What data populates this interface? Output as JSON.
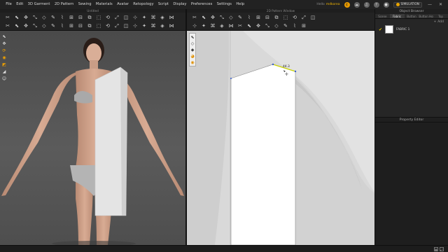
{
  "menubar": {
    "items": [
      "File",
      "Edit",
      "3D Garment",
      "2D Pattern",
      "Sewing",
      "Materials",
      "Avatar",
      "Retopology",
      "Script",
      "Display",
      "Preferences",
      "Settings",
      "Help"
    ],
    "user_prefix": "Hello",
    "user_name": "mdkorea",
    "simulation_label": "SIMULATION",
    "icons": [
      "coin-icon",
      "cloud-icon",
      "headset-icon",
      "help-icon",
      "user-icon"
    ],
    "minimize": "—",
    "close": "✕"
  },
  "window3d": {
    "title": "Untitled",
    "toolbar_icons": 38,
    "side_tools": [
      "select-icon",
      "move-icon",
      "rotate-icon",
      "pin-icon",
      "fold-icon",
      "measure-icon",
      "avatar-icon"
    ]
  },
  "window2d": {
    "title": "2D Pattern Window",
    "toolbar_icons": 27,
    "side_tools": [
      "arrow-icon",
      "edit-point-icon",
      "segment-icon",
      "curve-icon",
      "texture-icon"
    ],
    "segment_length": "44.3"
  },
  "object_browser": {
    "title": "Object Browser",
    "tabs": [
      "Scene",
      "Fabric",
      "Button",
      "Button Hole",
      "Top"
    ],
    "active_tab": "Fabric",
    "add_label": "Add",
    "items": [
      {
        "name": "FABRIC 1",
        "color": "#ffffff"
      }
    ]
  },
  "property_editor": {
    "title": "Property Editor"
  },
  "statusbar": {
    "left": "",
    "corner_icons": [
      "grid-icon",
      "expand-icon"
    ]
  },
  "colors": {
    "accent": "#e89a00",
    "selected_segment": "#c8d000",
    "pattern_fill": "#ffffff",
    "viewport3d": "#555555",
    "viewport2d": "#d9d9d9"
  }
}
